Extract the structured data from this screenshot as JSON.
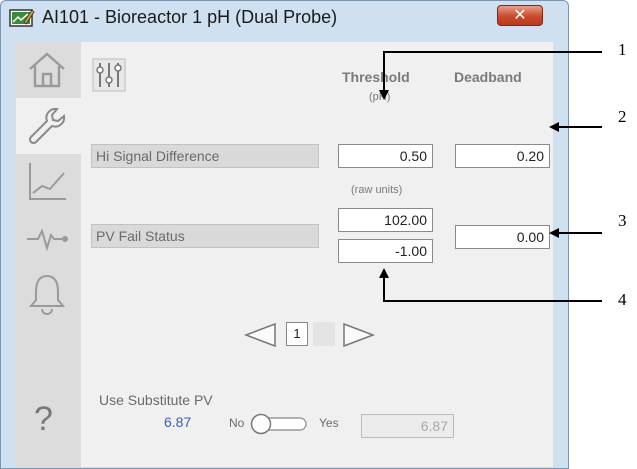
{
  "window": {
    "title": "AI101 - Bioreactor 1 pH (Dual Probe)",
    "close_glyph": "✕"
  },
  "nav": {
    "tabs": [
      "home-icon",
      "wrench-icon",
      "trend-icon",
      "diagnostics-icon",
      "alarm-bell-icon"
    ],
    "active_tab": "wrench-icon",
    "help_glyph": "?"
  },
  "headers": {
    "threshold": "Threshold",
    "threshold_unit": "(pH)",
    "deadband": "Deadband",
    "raw_units": "(raw units)"
  },
  "rows": {
    "hi_signal_difference": {
      "label": "Hi Signal Difference",
      "threshold": "0.50",
      "deadband": "0.20"
    },
    "pv_fail_status": {
      "label": "PV Fail Status",
      "threshold_high": "102.00",
      "threshold_low": "-1.00",
      "deadband": "0.00"
    }
  },
  "pager": {
    "current_page": "1"
  },
  "substitute": {
    "label": "Use Substitute PV",
    "pv_value": "6.87",
    "no_label": "No",
    "yes_label": "Yes",
    "toggle_state": "No",
    "substitute_value": "6.87"
  },
  "callouts": [
    "1",
    "2",
    "3",
    "4"
  ],
  "colors": {
    "window_frame": "#cfe0f1",
    "close_button": "#c94a2b",
    "pv_value_text": "#3a5fb5"
  }
}
